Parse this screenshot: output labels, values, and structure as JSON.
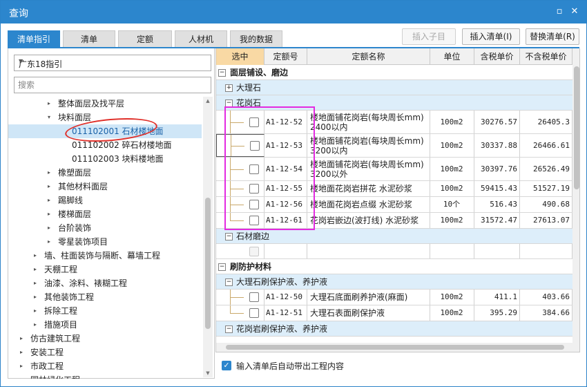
{
  "window": {
    "title": "查询"
  },
  "tabs": [
    "清单指引",
    "清单",
    "定额",
    "人材机",
    "我的数据"
  ],
  "buttons": {
    "insert_child": "插入子目",
    "insert_list": "插入清单(I)",
    "replace_list": "替换清单(R)"
  },
  "left": {
    "selector_value": "广东18指引",
    "search_placeholder": "搜索",
    "tree": [
      {
        "label": "整体面层及找平层",
        "toggle": "▸",
        "level": 3
      },
      {
        "label": "块料面层",
        "toggle": "▾",
        "level": 3
      },
      {
        "label": "011102001  石材楼地面",
        "toggle": "",
        "level": 4,
        "selected": true
      },
      {
        "label": "011102002  碎石材楼地面",
        "toggle": "",
        "level": 4
      },
      {
        "label": "011102003  块料楼地面",
        "toggle": "",
        "level": 4
      },
      {
        "label": "橡塑面层",
        "toggle": "▸",
        "level": 3
      },
      {
        "label": "其他材料面层",
        "toggle": "▸",
        "level": 3
      },
      {
        "label": "踢脚线",
        "toggle": "▸",
        "level": 3
      },
      {
        "label": "楼梯面层",
        "toggle": "▸",
        "level": 3
      },
      {
        "label": "台阶装饰",
        "toggle": "▸",
        "level": 3
      },
      {
        "label": "零星装饰项目",
        "toggle": "▸",
        "level": 3
      },
      {
        "label": "墙、柱面装饰与隔断、幕墙工程",
        "toggle": "▸",
        "level": 2
      },
      {
        "label": "天棚工程",
        "toggle": "▸",
        "level": 2
      },
      {
        "label": "油漆、涂料、裱糊工程",
        "toggle": "▸",
        "level": 2
      },
      {
        "label": "其他装饰工程",
        "toggle": "▸",
        "level": 2
      },
      {
        "label": "拆除工程",
        "toggle": "▸",
        "level": 2
      },
      {
        "label": "措施项目",
        "toggle": "▸",
        "level": 2
      },
      {
        "label": "仿古建筑工程",
        "toggle": "▸",
        "level": 1
      },
      {
        "label": "安装工程",
        "toggle": "▸",
        "level": 1
      },
      {
        "label": "市政工程",
        "toggle": "▸",
        "level": 1
      },
      {
        "label": "园林绿化工程",
        "toggle": "▸",
        "level": 1
      }
    ]
  },
  "table": {
    "headers": [
      "选中",
      "定额号",
      "定额名称",
      "单位",
      "含税单价",
      "不含税单价"
    ],
    "groups": {
      "g1": "面层铺设、磨边",
      "g1a": "大理石",
      "g1b": "花岗石",
      "g1c": "石材磨边",
      "g2": "刷防护材料",
      "g2a": "大理石刷保护液、养护液",
      "g2b": "花岗岩刷保护液、养护液"
    },
    "rows": [
      {
        "code": "A1-12-52",
        "name": "楼地面铺花岗岩(每块周长mm) 2400以内",
        "unit": "100m2",
        "tax": "30276.57",
        "notax": "26405.3"
      },
      {
        "code": "A1-12-53",
        "name": "楼地面铺花岗岩(每块周长mm) 3200以内",
        "unit": "100m2",
        "tax": "30337.88",
        "notax": "26466.61"
      },
      {
        "code": "A1-12-54",
        "name": "楼地面铺花岗岩(每块周长mm) 3200以外",
        "unit": "100m2",
        "tax": "30397.76",
        "notax": "26526.49"
      },
      {
        "code": "A1-12-55",
        "name": "楼地面花岗岩拼花 水泥砂浆",
        "unit": "100m2",
        "tax": "59415.43",
        "notax": "51527.19"
      },
      {
        "code": "A1-12-56",
        "name": "楼地面花岗岩点缀 水泥砂浆",
        "unit": "10个",
        "tax": "516.43",
        "notax": "490.68"
      },
      {
        "code": "A1-12-61",
        "name": "花岗岩嵌边(波打线) 水泥砂浆",
        "unit": "100m2",
        "tax": "31572.47",
        "notax": "27613.07"
      },
      {
        "code": "A1-12-50",
        "name": "大理石底面刷养护液(麻面)",
        "unit": "100m2",
        "tax": "411.1",
        "notax": "403.66"
      },
      {
        "code": "A1-12-51",
        "name": "大理石表面刷保护液",
        "unit": "100m2",
        "tax": "395.29",
        "notax": "384.66"
      }
    ]
  },
  "footer": {
    "auto_label": "输入清单后自动带出工程内容",
    "auto_checked": true
  },
  "colors": {
    "accent": "#2c86cd",
    "highlight_header": "#f9d9a4",
    "subgroup_bg": "#ddeefa",
    "annotation_red": "#e0302a",
    "annotation_magenta": "#e32ae0"
  }
}
